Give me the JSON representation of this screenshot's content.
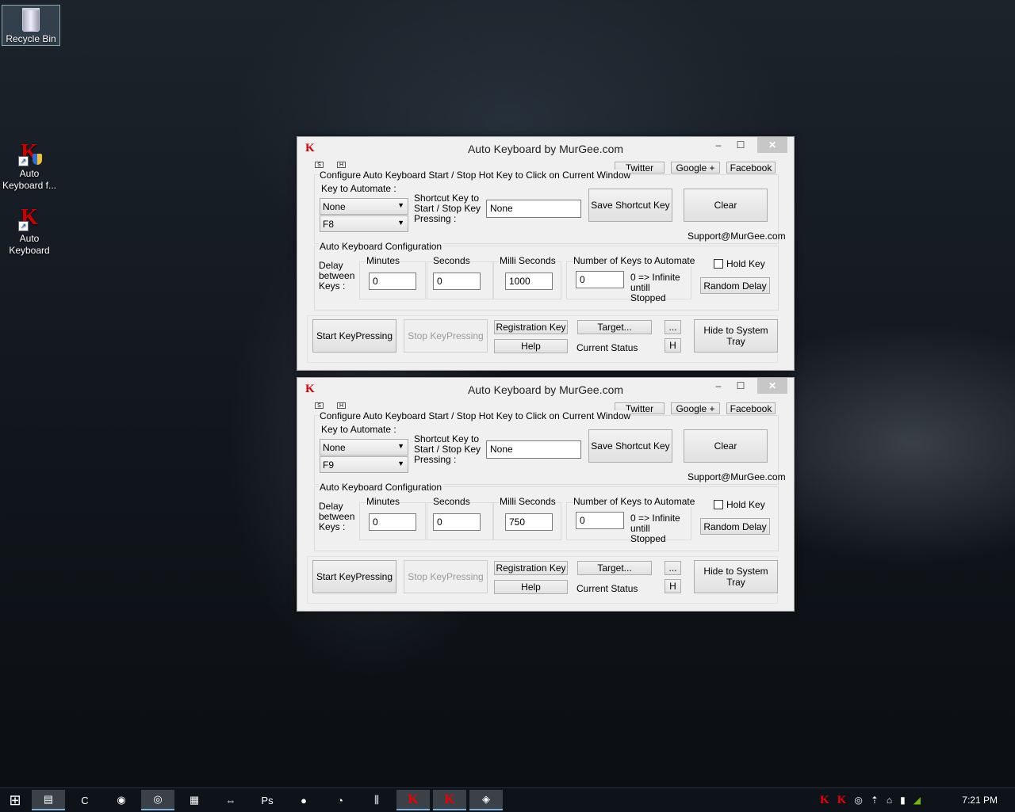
{
  "desktop": {
    "icons": [
      {
        "label": "Recycle Bin"
      },
      {
        "label": "Auto Keyboard f..."
      },
      {
        "label": "Auto Keyboard"
      }
    ]
  },
  "windows": [
    {
      "title": "Auto Keyboard by MurGee.com",
      "app_glyph": "K",
      "controls": {
        "minimize": "–",
        "maximize": "☐",
        "close": "✕"
      },
      "tiny_s": "S",
      "tiny_h": "H",
      "twitter": "Twitter",
      "google": "Google +",
      "facebook": "Facebook",
      "hotkey_caption": "Configure Auto Keyboard Start / Stop Hot Key to Click on Current Window",
      "key_to_automate_label": "Key to Automate :",
      "key_select": "None",
      "key_select2": "F8",
      "shortcut_label": "Shortcut Key to Start / Stop Key Pressing :",
      "shortcut_value": "None",
      "save_shortcut": "Save Shortcut Key",
      "clear": "Clear",
      "support": "Support@MurGee.com",
      "config_caption": "Auto Keyboard Configuration",
      "delay_label": "Delay between Keys :",
      "minutes_label": "Minutes",
      "minutes_value": "0",
      "seconds_label": "Seconds",
      "seconds_value": "0",
      "ms_label": "Milli Seconds",
      "ms_value": "1000",
      "num_keys_label": "Number of Keys to Automate",
      "num_keys_value": "0",
      "infinite_note": "0 => Infinite untill Stopped",
      "hold_key": "Hold Key",
      "random_delay": "Random Delay",
      "start": "Start KeyPressing",
      "stop": "Stop KeyPressing",
      "registration": "Registration Key",
      "help": "Help",
      "target": "Target...",
      "current_status": "Current Status",
      "dots": "...",
      "h_btn": "H",
      "hide_tray": "Hide to System Tray"
    },
    {
      "title": "Auto Keyboard by MurGee.com",
      "app_glyph": "K",
      "controls": {
        "minimize": "–",
        "maximize": "☐",
        "close": "✕"
      },
      "tiny_s": "S",
      "tiny_h": "H",
      "twitter": "Twitter",
      "google": "Google +",
      "facebook": "Facebook",
      "hotkey_caption": "Configure Auto Keyboard Start / Stop Hot Key to Click on Current Window",
      "key_to_automate_label": "Key to Automate :",
      "key_select": "None",
      "key_select2": "F9",
      "shortcut_label": "Shortcut Key to Start / Stop Key Pressing :",
      "shortcut_value": "None",
      "save_shortcut": "Save Shortcut Key",
      "clear": "Clear",
      "support": "Support@MurGee.com",
      "config_caption": "Auto Keyboard Configuration",
      "delay_label": "Delay between Keys :",
      "minutes_label": "Minutes",
      "minutes_value": "0",
      "seconds_label": "Seconds",
      "seconds_value": "0",
      "ms_label": "Milli Seconds",
      "ms_value": "750",
      "num_keys_label": "Number of Keys to Automate",
      "num_keys_value": "0",
      "infinite_note": "0 => Infinite untill Stopped",
      "hold_key": "Hold Key",
      "random_delay": "Random Delay",
      "start": "Start KeyPressing",
      "stop": "Stop KeyPressing",
      "registration": "Registration Key",
      "help": "Help",
      "target": "Target...",
      "current_status": "Current Status",
      "dots": "...",
      "h_btn": "H",
      "hide_tray": "Hide to System Tray"
    }
  ],
  "taskbar": {
    "start_glyph": "⊞",
    "items": [
      {
        "icon": "file-explorer-icon",
        "glyph": "▤"
      },
      {
        "icon": "ccleaner-icon",
        "glyph": "C"
      },
      {
        "icon": "chrome-icon",
        "glyph": "◉"
      },
      {
        "icon": "steam-icon",
        "glyph": "◎"
      },
      {
        "icon": "battlenet-icon",
        "glyph": "▦"
      },
      {
        "icon": "teamviewer-icon",
        "glyph": "⇔"
      },
      {
        "icon": "photoshop-icon",
        "glyph": "Ps"
      },
      {
        "icon": "osu-icon",
        "glyph": "●"
      },
      {
        "icon": "clock-app-icon",
        "glyph": "◔"
      },
      {
        "icon": "mixer-icon",
        "glyph": "⫼"
      },
      {
        "icon": "auto-keyboard-icon",
        "glyph": "K"
      },
      {
        "icon": "auto-keyboard-icon",
        "glyph": "K"
      },
      {
        "icon": "paint-icon",
        "glyph": "◈"
      }
    ],
    "tray_glyphs": [
      "K",
      "K",
      "◎",
      "⇡",
      "⌂",
      "▮",
      "◢"
    ],
    "clock": "7:21 PM"
  },
  "colors": {
    "accent_red": "#d00000",
    "taskbar_bg": "#0e131a"
  }
}
